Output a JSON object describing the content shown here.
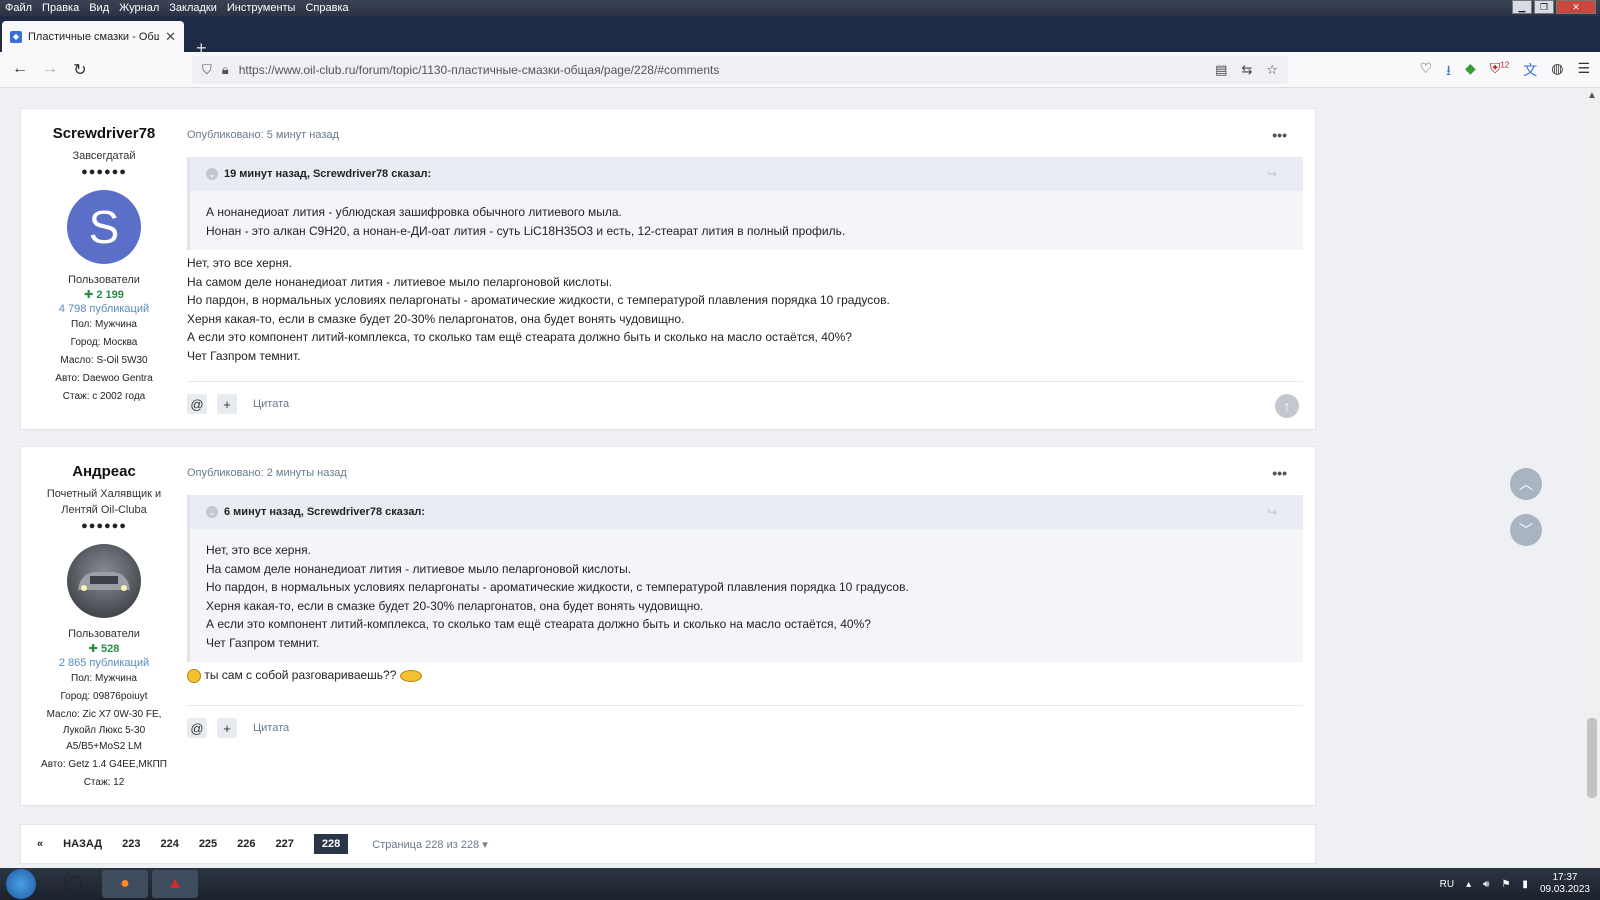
{
  "menubar": {
    "items": [
      "Файл",
      "Правка",
      "Вид",
      "Журнал",
      "Закладки",
      "Инструменты",
      "Справка"
    ]
  },
  "tab": {
    "title": "Пластичные смазки - Общая",
    "close": "✕"
  },
  "address": {
    "url": "https://www.oil-club.ru/forum/topic/1130-пластичные-смазки-общая/page/228/#comments"
  },
  "posts": [
    {
      "author": "Screwdriver78",
      "rank": "Завсегдатай",
      "avatar_letter": "S",
      "avatar_color": "#5b6ec8",
      "group": "Пользователи",
      "reputation": "2 199",
      "publications": "4 798 публикаций",
      "info": [
        "Пол: Мужчина",
        "Город: Москва",
        "Масло: S-Oil 5W30",
        "Авто: Daewoo Gentra",
        "Стаж: с 2002 года"
      ],
      "meta": "Опубликовано: 5 минут назад",
      "quote_head": "19 минут назад, Screwdriver78 сказал:",
      "quote_lines": [
        "А нонанедиоат лития - ублюдская зашифровка обычного литиевого мыла.",
        "Нонан - это алкан С9Н20, а нонан-е-ДИ-оат лития - суть LiC18H35O3 и есть, 12-стеарат лития в полный профиль."
      ],
      "body_lines": [
        "Нет, это все херня.",
        "На самом деле нонанедиоат лития - литиевое мыло пеларгоновой кислоты.",
        "Но пардон, в нормальных условиях пеларгонаты - ароматические жидкости, с температурой плавления порядка 10 градусов.",
        "Херня какая-то, если в смазке будет 20-30% пеларгонатов, она будет вонять чудовищно.",
        "А если это компонент литий-комплекса, то сколько там ещё стеарата должно быть и сколько на масло остаётся, 40%?",
        "Чет Газпром темнит."
      ]
    },
    {
      "author": "Андреас",
      "rank": "Почетный Халявщик и Лентяй Oil-Clubа",
      "group": "Пользователи",
      "reputation": "528",
      "publications": "2 865 публикаций",
      "info": [
        "Пол: Мужчина",
        "Город: 09876poiuyt",
        "Масло: Zic X7 0W-30 FE, Лукойл Люкс 5-30 A5/B5+MoS2 LM",
        "Авто: Getz 1.4 G4EE,МКПП",
        "Стаж: 12"
      ],
      "meta": "Опубликовано: 2 минуты назад",
      "quote_head": "6 минут назад, Screwdriver78 сказал:",
      "quote_lines": [
        "Нет, это все херня.",
        "На самом деле нонанедиоат лития - литиевое мыло пеларгоновой кислоты.",
        "Но пардон, в нормальных условиях пеларгонаты - ароматические жидкости, с температурой плавления порядка 10 градусов.",
        "Херня какая-то, если в смазке будет 20-30% пеларгонатов, она будет вонять чудовищно.",
        "А если это компонент литий-комплекса, то сколько там ещё стеарата должно быть и сколько на масло остаётся, 40%?",
        "Чет Газпром темнит."
      ],
      "reply": "ты сам с собой разговариваешь??"
    }
  ],
  "actions": {
    "mention": "@",
    "plus": "+",
    "cite": "Цитата"
  },
  "pager": {
    "prev_arrow": "«",
    "back": "НАЗАД",
    "pages": [
      "223",
      "224",
      "225",
      "226",
      "227"
    ],
    "current": "228",
    "page_of": "Страница 228 из 228 ▾"
  },
  "taskbar": {
    "lang": "RU",
    "time": "17:37",
    "date": "09.03.2023",
    "badge": "12"
  }
}
